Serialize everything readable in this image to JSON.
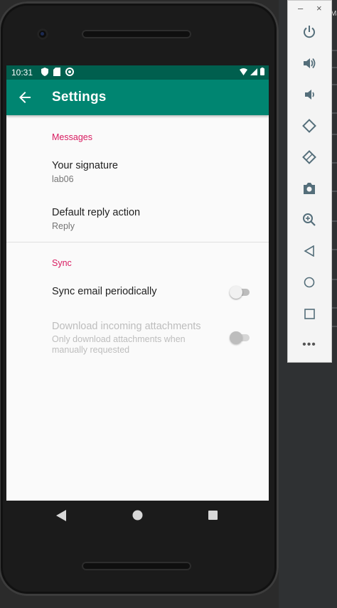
{
  "status_bar": {
    "time": "10:31"
  },
  "app_bar": {
    "title": "Settings"
  },
  "sections": [
    {
      "category": "Messages",
      "items": [
        {
          "title": "Your signature",
          "summary": "lab06"
        },
        {
          "title": "Default reply action",
          "summary": "Reply"
        }
      ]
    },
    {
      "category": "Sync",
      "items": [
        {
          "title": "Sync email periodically",
          "switch_on": false,
          "enabled": true
        },
        {
          "title": "Download incoming attachments",
          "summary": "Only download attachments when manually requested",
          "switch_on": false,
          "enabled": false
        }
      ]
    }
  ],
  "emulator_toolbar": {
    "window_controls": [
      "–",
      "×"
    ],
    "buttons": [
      "power-icon",
      "volume-up-icon",
      "volume-down-icon",
      "rotate-left-icon",
      "rotate-right-icon",
      "camera-icon",
      "zoom-icon",
      "back-icon",
      "home-icon",
      "overview-icon",
      "more-icon"
    ],
    "more_label": "•••"
  },
  "ide_fragment": {
    "label": "Ma"
  },
  "colors": {
    "status_bar": "#005f4e",
    "app_bar": "#008571",
    "accent": "#d81b60"
  }
}
